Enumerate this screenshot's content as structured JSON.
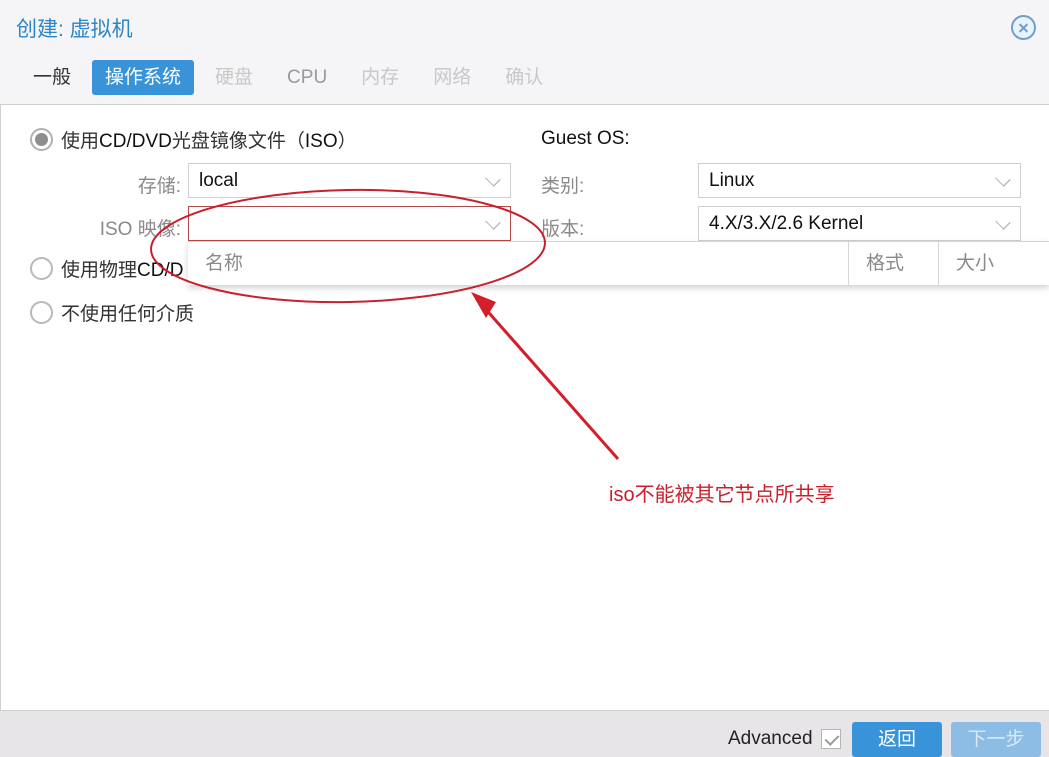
{
  "window": {
    "title": "创建: 虚拟机",
    "close_icon": "close-circle-icon"
  },
  "tabs": [
    {
      "label": "一般",
      "state": "done"
    },
    {
      "label": "操作系统",
      "state": "active"
    },
    {
      "label": "硬盘",
      "state": "disabled"
    },
    {
      "label": "CPU",
      "state": "disabled"
    },
    {
      "label": "内存",
      "state": "disabled"
    },
    {
      "label": "网络",
      "state": "disabled"
    },
    {
      "label": "确认",
      "state": "disabled"
    }
  ],
  "media": {
    "options": [
      {
        "label_prefix": "使用",
        "label_latin": "CD/DVD",
        "label_suffix": "光盘镜像文件（",
        "label_latin2": "ISO",
        "label_end": "）",
        "checked": true
      },
      {
        "label_prefix": "使用物理",
        "label_latin": "CD/D",
        "checked": false
      },
      {
        "label": "不使用任何介质",
        "checked": false
      }
    ],
    "storage": {
      "label": "存储:",
      "value": "local"
    },
    "iso_image": {
      "label": "ISO 映像:",
      "value": ""
    }
  },
  "guest_os": {
    "heading": "Guest OS:",
    "type": {
      "label": "类别:",
      "value": "Linux"
    },
    "version": {
      "label": "版本:",
      "value": "4.X/3.X/2.6 Kernel"
    }
  },
  "iso_dropdown": {
    "columns": [
      "名称",
      "格式",
      "大小"
    ]
  },
  "annotation": {
    "text": "iso不能被其它节点所共享",
    "color": "#c8202d"
  },
  "footer": {
    "advanced_label": "Advanced",
    "advanced_checked": true,
    "back_label": "返回",
    "next_label": "下一步"
  },
  "colors": {
    "accent": "#3893d8",
    "title": "#2e86c8",
    "invalid_border": "#b54848"
  }
}
